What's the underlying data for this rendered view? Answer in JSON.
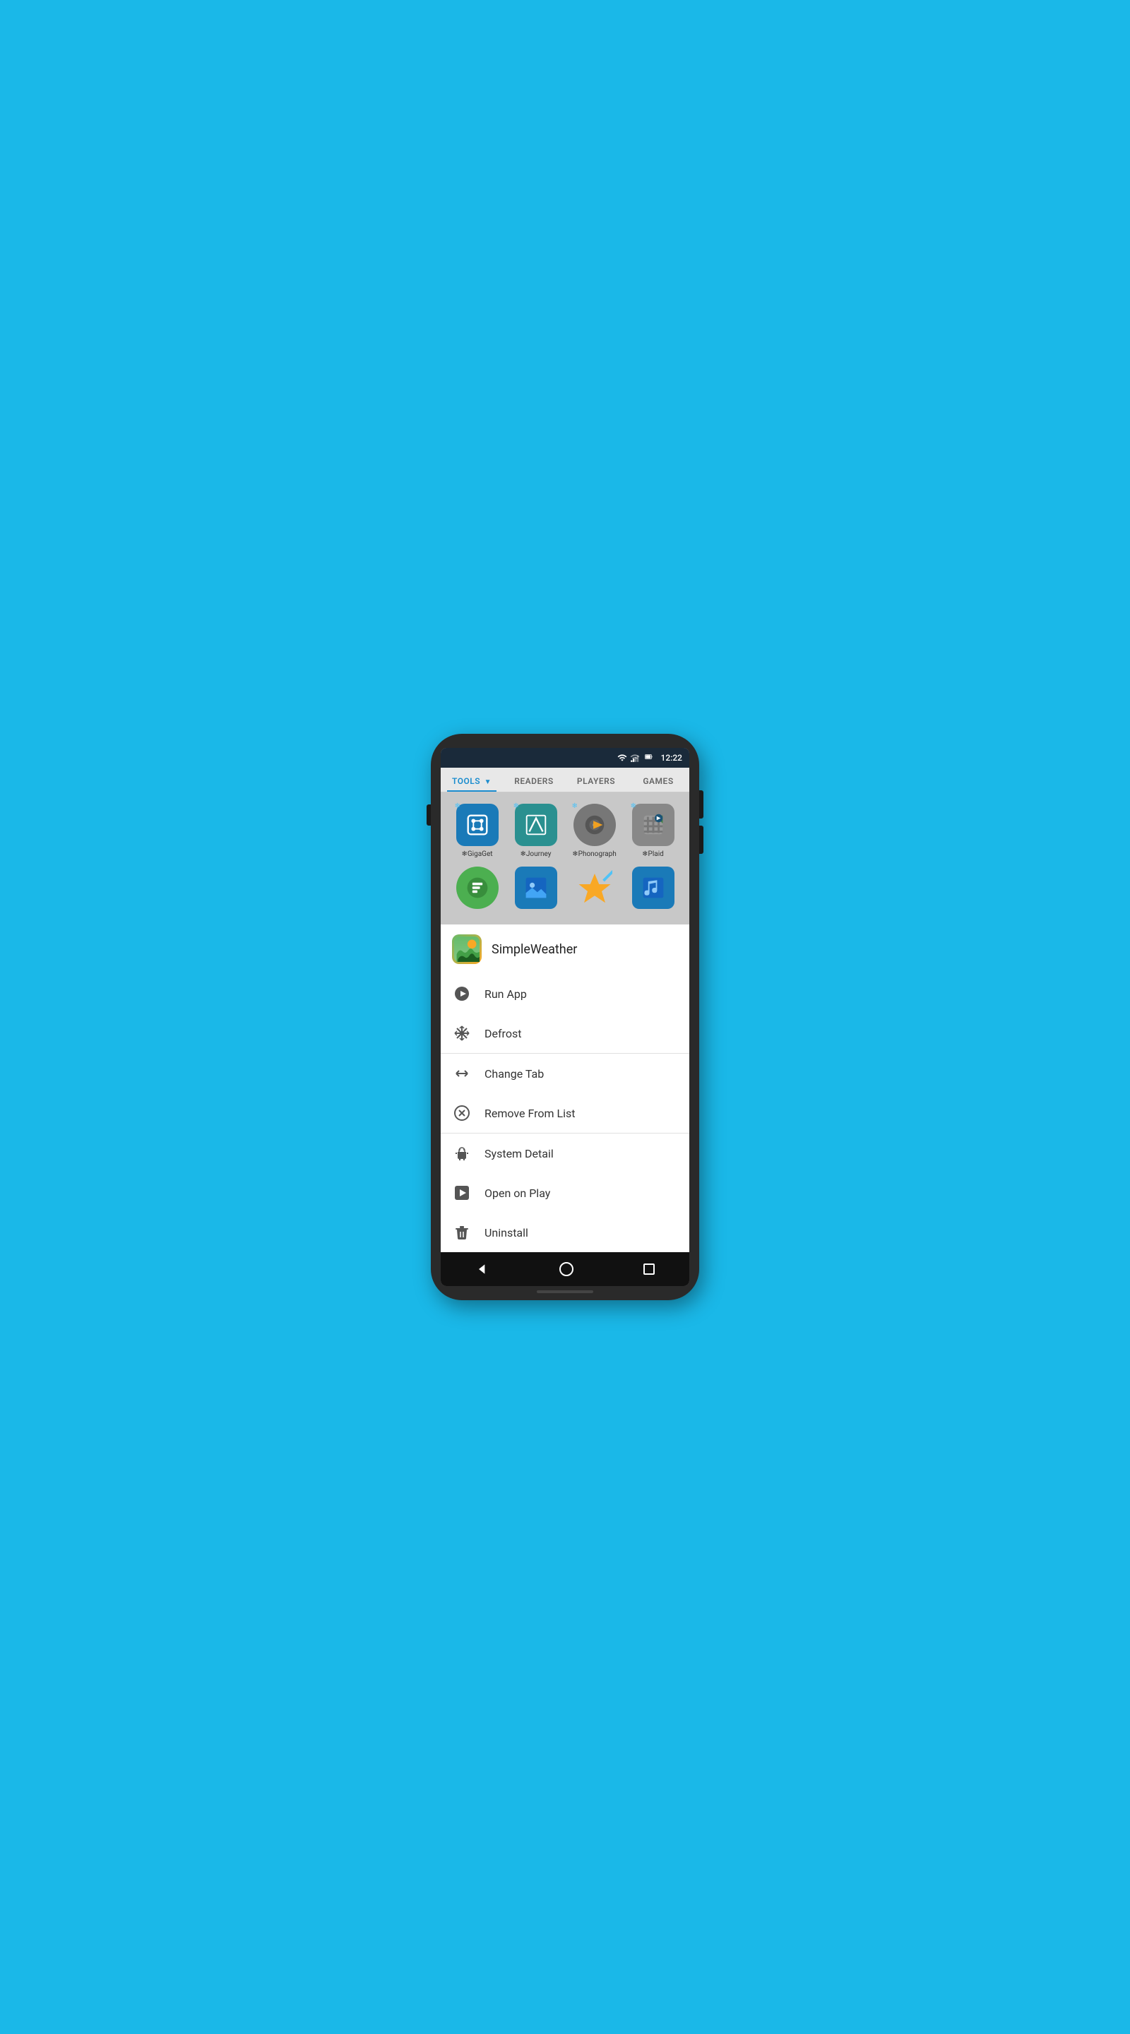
{
  "phone": {
    "status_bar": {
      "time": "12:22"
    },
    "tabs": [
      {
        "id": "tools",
        "label": "TOOLS",
        "active": true,
        "has_arrow": true
      },
      {
        "id": "readers",
        "label": "READERS",
        "active": false
      },
      {
        "id": "players",
        "label": "PLAYERS",
        "active": false
      },
      {
        "id": "games",
        "label": "GAMES",
        "active": false
      }
    ],
    "app_grid": {
      "row1": [
        {
          "name": "GigaGet",
          "icon_type": "gigaget",
          "frozen": true
        },
        {
          "name": "Journey",
          "icon_type": "journey",
          "frozen": true
        },
        {
          "name": "Phonograph",
          "icon_type": "phonograph",
          "frozen": true
        },
        {
          "name": "Plaid",
          "icon_type": "plaid",
          "frozen": true
        }
      ],
      "row2_partial": [
        {
          "name": "",
          "icon_type": "pushbullet",
          "frozen": false
        },
        {
          "name": "",
          "icon_type": "wallpaper",
          "frozen": false
        },
        {
          "name": "",
          "icon_type": "star",
          "frozen": false
        },
        {
          "name": "",
          "icon_type": "music",
          "frozen": false
        }
      ]
    },
    "context_menu": {
      "app_name": "SimpleWeather",
      "items": [
        {
          "id": "run-app",
          "label": "Run App",
          "icon": "play"
        },
        {
          "id": "defrost",
          "label": "Defrost",
          "icon": "snowflake"
        },
        {
          "id": "change-tab",
          "label": "Change Tab",
          "icon": "change"
        },
        {
          "id": "remove-from-list",
          "label": "Remove From List",
          "icon": "remove"
        },
        {
          "id": "system-detail",
          "label": "System Detail",
          "icon": "android"
        },
        {
          "id": "open-on-play",
          "label": "Open on Play",
          "icon": "play-store"
        },
        {
          "id": "uninstall",
          "label": "Uninstall",
          "icon": "trash"
        }
      ]
    }
  }
}
